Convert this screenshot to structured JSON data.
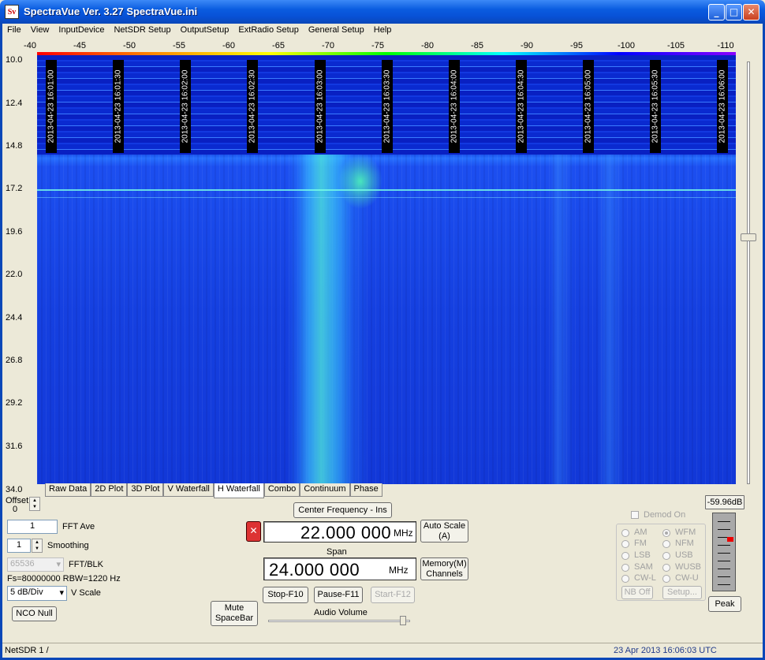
{
  "window": {
    "title": "SpectraVue Ver. 3.27  SpectraVue.ini",
    "icon": "Sv"
  },
  "menu": [
    "File",
    "View",
    "InputDevice",
    "NetSDR Setup",
    "OutputSetup",
    "ExtRadio Setup",
    "General Setup",
    "Help"
  ],
  "scale_labels": [
    "-40",
    "-45",
    "-50",
    "-55",
    "-60",
    "-65",
    "-70",
    "-75",
    "-80",
    "-85",
    "-90",
    "-95",
    "-100",
    "-105",
    "-110"
  ],
  "y_labels": [
    "10.0",
    "12.4",
    "14.8",
    "17.2",
    "19.6",
    "22.0",
    "24.4",
    "26.8",
    "29.2",
    "31.6",
    "34.0"
  ],
  "timestamps": [
    "2013-04-23 16:01:00",
    "2013-04-23 16:01:30",
    "2013-04-23 16:02:00",
    "2013-04-23 16:02:30",
    "2013-04-23 16:03:00",
    "2013-04-23 16:03:30",
    "2013-04-23 16:04:00",
    "2013-04-23 16:04:30",
    "2013-04-23 16:05:00",
    "2013-04-23 16:05:30",
    "2013-04-23 16:06:00"
  ],
  "tabs": [
    "Raw Data",
    "2D Plot",
    "3D Plot",
    "V Waterfall",
    "H Waterfall",
    "Combo",
    "Continuum",
    "Phase"
  ],
  "controls": {
    "offset_label": "Offset",
    "offset_value": "0",
    "fft_ave_value": "1",
    "fft_ave_label": "FFT Ave",
    "smoothing_value": "1",
    "smoothing_label": "Smoothing",
    "fft_blk_value": "65536",
    "fft_blk_label": "FFT/BLK",
    "fs_rbw": "Fs=80000000 RBW=1220 Hz",
    "vscale_value": "5 dB/Div",
    "vscale_label": "V Scale",
    "nco_null": "NCO Null",
    "mute_line1": "Mute",
    "mute_line2": "SpaceBar",
    "center_freq_button": "Center Frequency - Ins",
    "center_freq_value": "22.000 000",
    "center_freq_unit": "MHz",
    "auto_scale_line1": "Auto Scale",
    "auto_scale_line2": "(A)",
    "span_label": "Span",
    "span_value": "24.000 000",
    "span_unit": "MHz",
    "memory_line1": "Memory(M)",
    "memory_line2": "Channels",
    "stop": "Stop-F10",
    "pause": "Pause-F11",
    "start": "Start-F12",
    "audio_volume": "Audio Volume",
    "audio_volume_level": 0.95,
    "waterfall_slider_level": 0.6
  },
  "demod": {
    "demod_on": "Demod On",
    "left": [
      "AM",
      "FM",
      "LSB",
      "SAM",
      "CW-L"
    ],
    "right": [
      "WFM",
      "NFM",
      "USB",
      "WUSB",
      "CW-U"
    ],
    "selected": "WFM",
    "nb_off": "NB Off",
    "setup": "Setup..."
  },
  "meter": {
    "reading": "-59.96dB",
    "peak": "Peak"
  },
  "status": {
    "left": "NetSDR 1  /",
    "right": "23 Apr 2013  16:06:03 UTC"
  }
}
